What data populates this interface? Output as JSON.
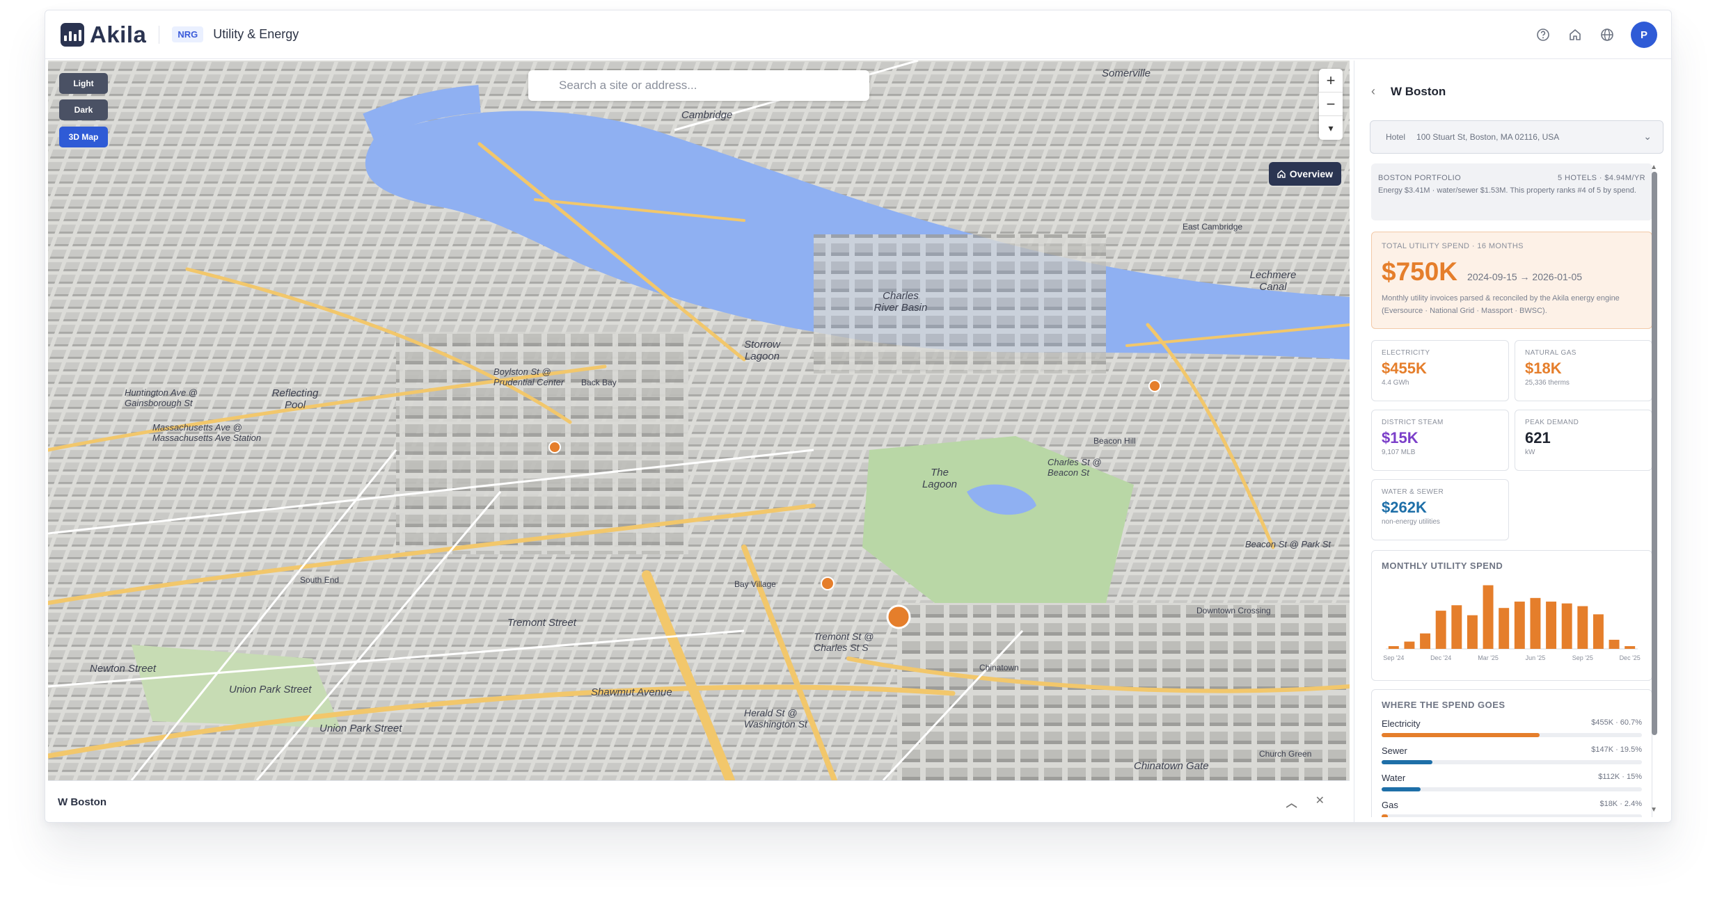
{
  "header": {
    "brand": "Akila",
    "badge": "NRG",
    "title": "Utility & Energy",
    "avatar_initial": "P"
  },
  "map": {
    "modes": [
      "Light",
      "Dark",
      "3D Map"
    ],
    "active_mode": "3D Map",
    "search_placeholder": "Search a site or address...",
    "zoom_in": "+",
    "zoom_out": "−",
    "compass": "▾",
    "overview_label": "Overview",
    "places": [
      {
        "name": "Cambridge"
      },
      {
        "name": "Somerville"
      },
      {
        "name": "Charles River Basin"
      },
      {
        "name": "Storrow Lagoon"
      },
      {
        "name": "Back Bay"
      },
      {
        "name": "Reflecting Pool"
      },
      {
        "name": "The Lagoon"
      },
      {
        "name": "Beacon Hill"
      },
      {
        "name": "South End"
      },
      {
        "name": "Bay Village"
      },
      {
        "name": "Chinatown"
      },
      {
        "name": "Downtown Crossing"
      },
      {
        "name": "Newton Street"
      },
      {
        "name": "Union Park Street"
      },
      {
        "name": "Union Park Street"
      },
      {
        "name": "Tremont Street"
      },
      {
        "name": "Shawmut Avenue"
      },
      {
        "name": "Huntington Ave @ Gainsborough St"
      },
      {
        "name": "Massachusetts Ave @ Massachusetts Ave Station"
      },
      {
        "name": "Herald St @ Washington St"
      },
      {
        "name": "Tremont St @ Charles St S"
      },
      {
        "name": "Boylston St @ Prudential Center"
      },
      {
        "name": "Charles St @ Beacon St"
      },
      {
        "name": "Beacon St @ Park St"
      },
      {
        "name": "Chinatown Gate"
      },
      {
        "name": "Church Green"
      },
      {
        "name": "Lechmere Canal"
      },
      {
        "name": "East Cambridge"
      }
    ]
  },
  "bottom": {
    "title": "W Boston"
  },
  "panel": {
    "title": "W Boston",
    "site_type": "Hotel",
    "site_address": "100 Stuart St, Boston, MA 02116, USA",
    "portfolio": {
      "label": "Boston Portfolio",
      "summary": "5 HOTELS · $4.94M/YR",
      "text": "Energy $3.41M · water/sewer $1.53M. This property ranks #4 of 5 by spend."
    },
    "total": {
      "label": "Total Utility Spend · 16 months",
      "amount": "$750K",
      "range": "2024-09-15 → 2026-01-05",
      "desc": "Monthly utility invoices parsed & reconciled by the Akila energy engine (Eversource · National Grid · Massport · BWSC)."
    },
    "kpis": [
      {
        "label": "Electricity",
        "value": "$455K",
        "sub": "4.4 GWh",
        "color": "#e57e2b"
      },
      {
        "label": "Natural Gas",
        "value": "$18K",
        "sub": "25,336 therms",
        "color": "#e57e2b"
      },
      {
        "label": "District Steam",
        "value": "$15K",
        "sub": "9,107 MLB",
        "color": "#7b3fc9"
      },
      {
        "label": "Peak Demand",
        "value": "621",
        "sub": "kW",
        "color": "#1f2430"
      },
      {
        "label": "Water & Sewer",
        "value": "$262K",
        "sub": "non-energy utilities",
        "color": "#1e6fa8"
      }
    ],
    "monthly_title": "Monthly Utility Spend",
    "spend_title": "Where the spend goes",
    "spend": [
      {
        "name": "Electricity",
        "value": "$455K · 60.7%",
        "pct": 60.7,
        "color": "#e57e2b"
      },
      {
        "name": "Sewer",
        "value": "$147K · 19.5%",
        "pct": 19.5,
        "color": "#1e6fa8"
      },
      {
        "name": "Water",
        "value": "$112K · 15%",
        "pct": 15,
        "color": "#1e6fa8"
      },
      {
        "name": "Gas",
        "value": "$18K · 2.4%",
        "pct": 2.4,
        "color": "#e57e2b"
      }
    ]
  },
  "chart_data": {
    "type": "bar",
    "title": "Monthly Utility Spend",
    "categories": [
      "Sep '24",
      "Oct '24",
      "Nov '24",
      "Dec '24",
      "Jan '25",
      "Feb '25",
      "Mar '25",
      "Apr '25",
      "May '25",
      "Jun '25",
      "Jul '25",
      "Aug '25",
      "Sep '25",
      "Oct '25",
      "Nov '25",
      "Dec '25"
    ],
    "tick_labels": [
      "Sep '24",
      "Dec '24",
      "Mar '25",
      "Jun '25",
      "Sep '25",
      "Dec '25"
    ],
    "values": [
      3,
      8,
      17,
      42,
      48,
      37,
      70,
      45,
      52,
      56,
      52,
      50,
      47,
      38,
      10,
      3
    ],
    "ylim": [
      0,
      75
    ],
    "color": "#e57e2b"
  }
}
